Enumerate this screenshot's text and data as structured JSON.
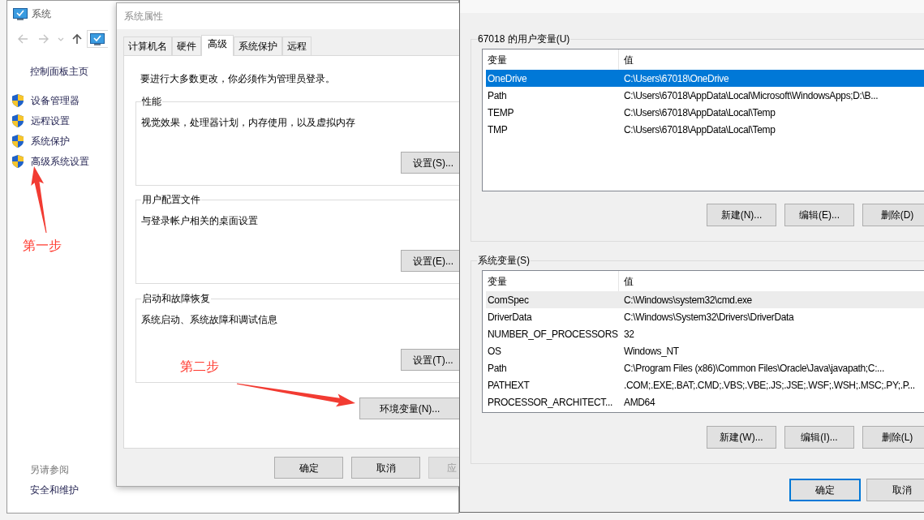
{
  "system_window": {
    "title": "系统",
    "sidebar_home": "控制面板主页",
    "sidebar_items": [
      {
        "label": "设备管理器"
      },
      {
        "label": "远程设置"
      },
      {
        "label": "系统保护"
      },
      {
        "label": "高级系统设置"
      }
    ],
    "see_also_heading": "另请参阅",
    "see_also_links": [
      "安全和维护"
    ]
  },
  "properties_dialog": {
    "title": "系统属性",
    "tabs": [
      {
        "label": "计算机名",
        "selected": false
      },
      {
        "label": "硬件",
        "selected": false
      },
      {
        "label": "高级",
        "selected": true
      },
      {
        "label": "系统保护",
        "selected": false
      },
      {
        "label": "远程",
        "selected": false
      }
    ],
    "notice": "要进行大多数更改，你必须作为管理员登录。",
    "groups": [
      {
        "title": "性能",
        "description": "视觉效果，处理器计划，内存使用，以及虚拟内存",
        "button": "设置(S)..."
      },
      {
        "title": "用户配置文件",
        "description": "与登录帐户相关的桌面设置",
        "button": "设置(E)..."
      },
      {
        "title": "启动和故障恢复",
        "description": "系统启动、系统故障和调试信息",
        "button": "设置(T)..."
      }
    ],
    "env_button": "环境变量(N)...",
    "buttons": [
      {
        "label": "确定",
        "disabled": false
      },
      {
        "label": "取消",
        "disabled": false
      },
      {
        "label": "应",
        "disabled": true
      }
    ]
  },
  "env_dialog": {
    "sections": [
      {
        "title": "67018 的用户变量(U)",
        "focused": true,
        "columns": [
          "变量",
          "值"
        ],
        "rows": [
          {
            "name": "OneDrive",
            "value": "C:\\Users\\67018\\OneDrive",
            "selected": true
          },
          {
            "name": "Path",
            "value": "C:\\Users\\67018\\AppData\\Local\\Microsoft\\WindowsApps;D:\\B...",
            "selected": false
          },
          {
            "name": "TEMP",
            "value": "C:\\Users\\67018\\AppData\\Local\\Temp",
            "selected": false
          },
          {
            "name": "TMP",
            "value": "C:\\Users\\67018\\AppData\\Local\\Temp",
            "selected": false
          }
        ],
        "buttons": [
          "新建(N)...",
          "编辑(E)...",
          "删除(D)"
        ]
      },
      {
        "title": "系统变量(S)",
        "focused": false,
        "columns": [
          "变量",
          "值"
        ],
        "rows": [
          {
            "name": "ComSpec",
            "value": "C:\\Windows\\system32\\cmd.exe",
            "selected": true
          },
          {
            "name": "DriverData",
            "value": "C:\\Windows\\System32\\Drivers\\DriverData",
            "selected": false
          },
          {
            "name": "NUMBER_OF_PROCESSORS",
            "value": "32",
            "selected": false
          },
          {
            "name": "OS",
            "value": "Windows_NT",
            "selected": false
          },
          {
            "name": "Path",
            "value": "C:\\Program Files (x86)\\Common Files\\Oracle\\Java\\javapath;C:...",
            "selected": false
          },
          {
            "name": "PATHEXT",
            "value": ".COM;.EXE;.BAT;.CMD;.VBS;.VBE;.JS;.JSE;.WSF;.WSH;.MSC;.PY;.P...",
            "selected": false
          },
          {
            "name": "PROCESSOR_ARCHITECT...",
            "value": "AMD64",
            "selected": false
          }
        ],
        "buttons": [
          "新建(W)...",
          "编辑(I)...",
          "删除(L)"
        ]
      }
    ],
    "buttons": [
      {
        "label": "确定",
        "default": true
      },
      {
        "label": "取消",
        "default": false
      }
    ]
  },
  "annotations": [
    {
      "text": "第一步"
    },
    {
      "text": "第二步"
    }
  ]
}
